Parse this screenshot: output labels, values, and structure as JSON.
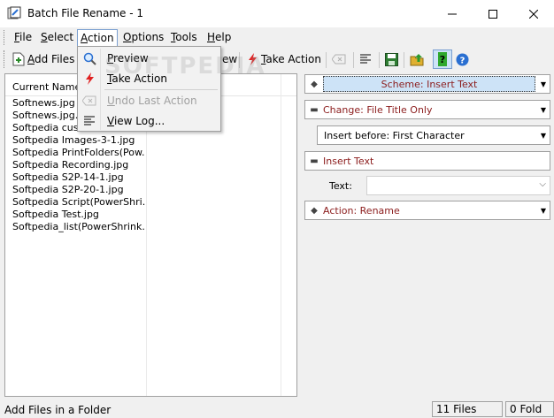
{
  "window": {
    "title": "Batch File Rename - 1"
  },
  "menu": [
    {
      "label": "File",
      "key": "F",
      "rest": "ile"
    },
    {
      "label": "Select",
      "key": "S",
      "rest": "elect"
    },
    {
      "label": "Action",
      "key": "A",
      "rest": "ction"
    },
    {
      "label": "Options",
      "key": "O",
      "rest": "ptions"
    },
    {
      "label": "Tools",
      "key": "T",
      "rest": "ools"
    },
    {
      "label": "Help",
      "key": "H",
      "rest": "elp"
    }
  ],
  "toolbar": {
    "add_files_key": "A",
    "add_files_rest": "dd Files",
    "preview_partial": "ew",
    "take_action_key": "T",
    "take_action_rest": "ake Action"
  },
  "action_menu": {
    "items": [
      {
        "label": "Preview",
        "key": "P",
        "rest": "review",
        "enabled": true,
        "icon": "magnifier-icon"
      },
      {
        "label": "Take Action",
        "key": "T",
        "rest": "ake Action",
        "enabled": true,
        "icon": "lightning-icon"
      },
      {
        "label": "Undo Last Action",
        "key": "U",
        "rest": "ndo Last Action",
        "enabled": false,
        "icon": "undo-eraser-icon"
      },
      {
        "label": "View Log...",
        "key": "V",
        "rest": "iew Log...",
        "enabled": true,
        "icon": "log-icon"
      }
    ]
  },
  "file_list": {
    "column_header": "Current Name",
    "rows": [
      "Softnews.jpg",
      "Softnews.jpg.a",
      "Softpedia custo",
      "Softpedia Images-3-1.jpg",
      "Softpedia PrintFolders(Pow...",
      "Softpedia Recording.jpg",
      "Softpedia S2P-14-1.jpg",
      "Softpedia S2P-20-1.jpg",
      "Softpedia Script(PowerShri...",
      "Softpedia Test.jpg",
      "Softpedia_list(PowerShrink..."
    ]
  },
  "right_panel": {
    "scheme": "Scheme: Insert Text",
    "change": "Change: File Title Only",
    "insert_position": "Insert before: First Character",
    "insert_text_header": "Insert Text",
    "text_label": "Text:",
    "text_value": "",
    "action": "Action: Rename"
  },
  "status": {
    "message": "Add Files in a Folder",
    "files_count": "11 Files",
    "folders_count": "0 Fold"
  },
  "watermark": "SOFTPEDIA",
  "colors": {
    "accent_text": "#8b1c1c",
    "selection": "#cde3f7"
  }
}
